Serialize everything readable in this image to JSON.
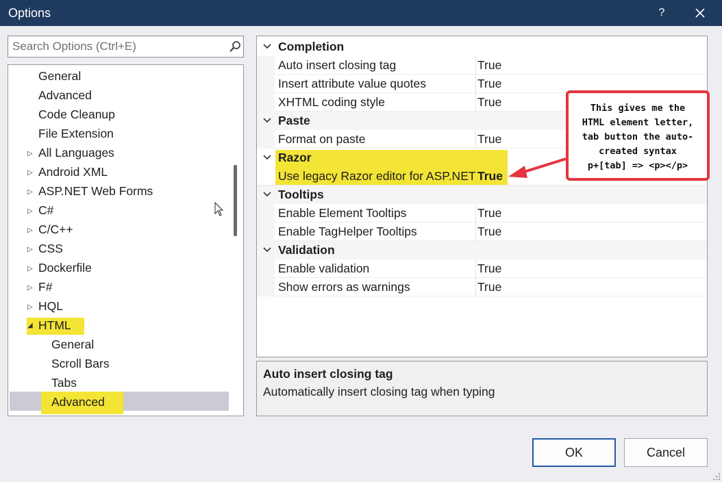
{
  "window": {
    "title": "Options",
    "help_glyph": "?"
  },
  "search": {
    "placeholder": "Search Options (Ctrl+E)"
  },
  "tree": {
    "items": [
      {
        "label": "General"
      },
      {
        "label": "Advanced"
      },
      {
        "label": "Code Cleanup"
      },
      {
        "label": "File Extension"
      },
      {
        "label": "All Languages"
      },
      {
        "label": "Android XML"
      },
      {
        "label": "ASP.NET Web Forms"
      },
      {
        "label": "C#"
      },
      {
        "label": "C/C++"
      },
      {
        "label": "CSS"
      },
      {
        "label": "Dockerfile"
      },
      {
        "label": "F#"
      },
      {
        "label": "HQL"
      },
      {
        "label": "HTML"
      },
      {
        "label": "General"
      },
      {
        "label": "Scroll Bars"
      },
      {
        "label": "Tabs"
      },
      {
        "label": "Advanced"
      }
    ]
  },
  "grid": {
    "categories": [
      {
        "label": "Completion",
        "props": [
          {
            "name": "Auto insert closing tag",
            "value": "True"
          },
          {
            "name": "Insert attribute value quotes",
            "value": "True"
          },
          {
            "name": "XHTML coding style",
            "value": "True"
          }
        ]
      },
      {
        "label": "Paste",
        "props": [
          {
            "name": "Format on paste",
            "value": "True"
          }
        ]
      },
      {
        "label": "Razor",
        "props": [
          {
            "name": "Use legacy Razor editor for ASP.NET",
            "value": "True"
          }
        ]
      },
      {
        "label": "Tooltips",
        "props": [
          {
            "name": "Enable Element Tooltips",
            "value": "True"
          },
          {
            "name": "Enable TagHelper Tooltips",
            "value": "True"
          }
        ]
      },
      {
        "label": "Validation",
        "props": [
          {
            "name": "Enable validation",
            "value": "True"
          },
          {
            "name": "Show errors as warnings",
            "value": "True"
          }
        ]
      }
    ]
  },
  "description": {
    "title": "Auto insert closing tag",
    "text": "Automatically insert closing tag when typing"
  },
  "annotation": {
    "lines": [
      "This gives me the",
      "HTML element letter,",
      "tab button the auto-",
      "created syntax",
      "p+[tab] => <p></p>"
    ]
  },
  "buttons": {
    "ok": "OK",
    "cancel": "Cancel"
  },
  "colors": {
    "titlebar": "#1f3a5f",
    "highlight": "#f3e436",
    "callout_border": "#e5343e",
    "selection": "#cbcbd6"
  }
}
